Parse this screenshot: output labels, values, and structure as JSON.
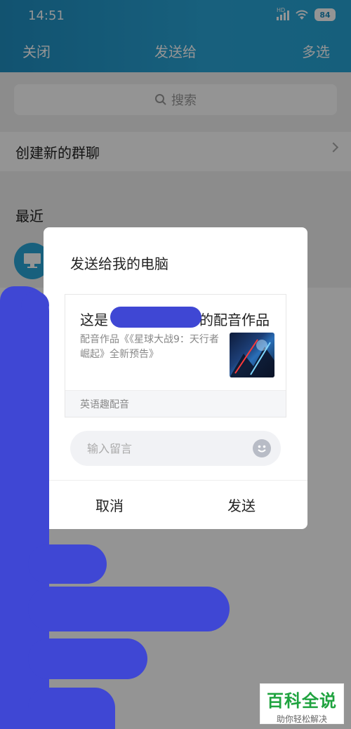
{
  "status_bar": {
    "time": "14:51",
    "battery": "84",
    "network_label": "HD"
  },
  "header": {
    "close_label": "关闭",
    "title": "发送给",
    "multi_select_label": "多选"
  },
  "search": {
    "placeholder": "搜索"
  },
  "list": {
    "create_group_label": "创建新的群聊",
    "recent_label": "最近"
  },
  "dialog": {
    "title": "发送给我的电脑",
    "card": {
      "title_prefix": "这是",
      "title_suffix": "的配音作品",
      "description": "配音作品《《星球大战9：天行者崛起》全新预告》",
      "source": "英语趣配音"
    },
    "message_placeholder": "输入留言",
    "cancel_label": "取消",
    "send_label": "发送"
  },
  "watermark": {
    "title": "百科全说",
    "subtitle": "助你轻松解决"
  },
  "colors": {
    "header": "#2aa6d8",
    "scribble": "#3f47d4",
    "watermark_green": "#1fa33f"
  }
}
